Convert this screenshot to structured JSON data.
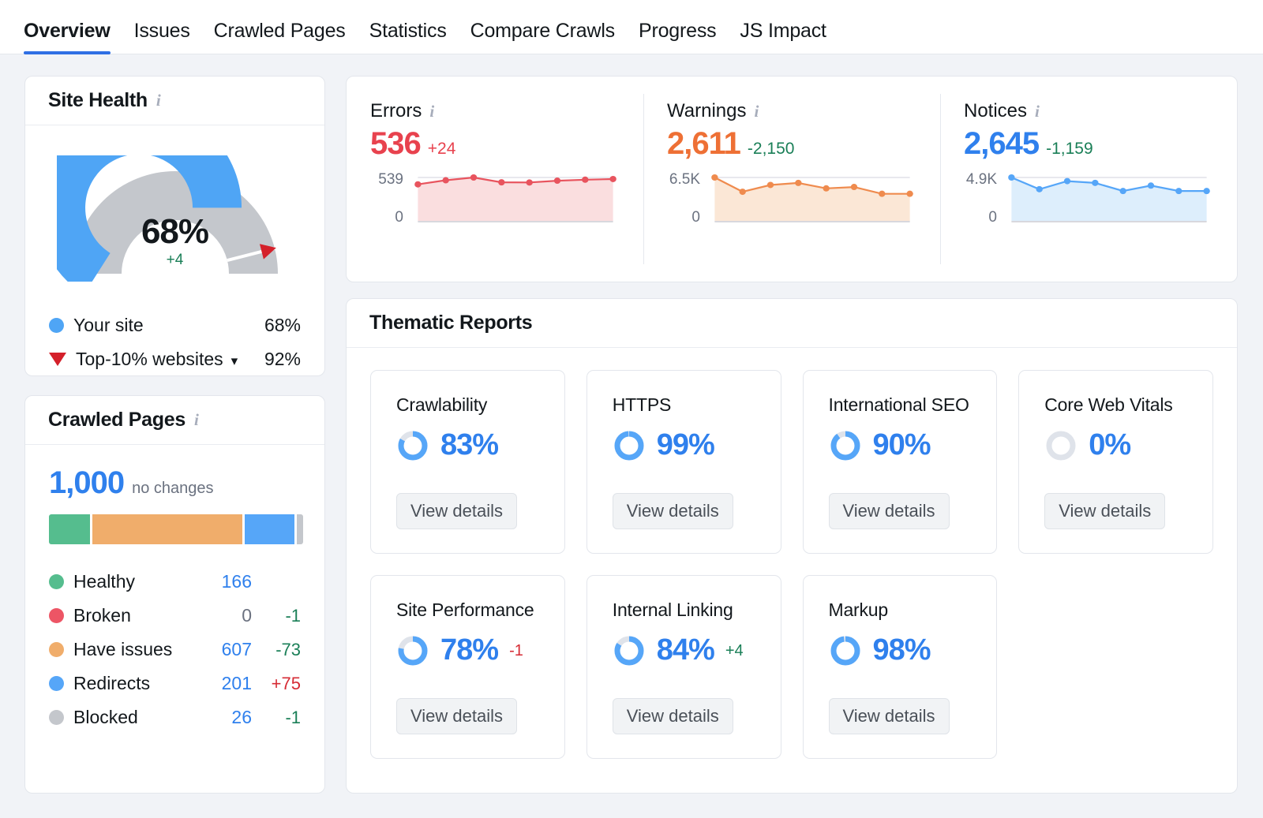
{
  "tabs": [
    {
      "label": "Overview",
      "active": true
    },
    {
      "label": "Issues",
      "active": false
    },
    {
      "label": "Crawled Pages",
      "active": false
    },
    {
      "label": "Statistics",
      "active": false
    },
    {
      "label": "Compare Crawls",
      "active": false
    },
    {
      "label": "Progress",
      "active": false
    },
    {
      "label": "JS Impact",
      "active": false
    }
  ],
  "site_health": {
    "title": "Site Health",
    "score": "68%",
    "delta": "+4",
    "legend": [
      {
        "label": "Your site",
        "value": "68%",
        "color": "#4fa5f5",
        "marker": "dot"
      },
      {
        "label": "Top-10% websites",
        "value": "92%",
        "color": "#d4202a",
        "marker": "triangle",
        "chevron": "⌄"
      }
    ],
    "chart_data": {
      "type": "gauge",
      "title": "Site Health",
      "value": 68,
      "benchmark": 92,
      "range": [
        0,
        100
      ],
      "series": [
        {
          "name": "Your site",
          "value": 68,
          "color": "#4fa5f5"
        },
        {
          "name": "Remaining",
          "value": 32,
          "color": "#c4c7cc"
        }
      ],
      "marker": {
        "name": "Top-10% websites",
        "value": 92,
        "color": "#d4202a"
      }
    }
  },
  "crawled_pages": {
    "title": "Crawled Pages",
    "total": "1,000",
    "total_note": "no changes",
    "rows": [
      {
        "label": "Healthy",
        "count": "166",
        "delta": "",
        "color": "#55bd8e",
        "count_style": "link",
        "delta_style": ""
      },
      {
        "label": "Broken",
        "count": "0",
        "delta": "-1",
        "color": "#ed5565",
        "count_style": "zero",
        "delta_style": "neg"
      },
      {
        "label": "Have issues",
        "count": "607",
        "delta": "-73",
        "color": "#f0ad6b",
        "count_style": "link",
        "delta_style": "neg"
      },
      {
        "label": "Redirects",
        "count": "201",
        "delta": "+75",
        "color": "#56a6f8",
        "count_style": "link",
        "delta_style": "pos"
      },
      {
        "label": "Blocked",
        "count": "26",
        "delta": "-1",
        "color": "#c4c7cc",
        "count_style": "link",
        "delta_style": "neg"
      }
    ],
    "chart_data": {
      "type": "bar",
      "subtype": "stacked-horizontal",
      "title": "Crawled Pages",
      "total": 1000,
      "categories": [
        "Healthy",
        "Broken",
        "Have issues",
        "Redirects",
        "Blocked"
      ],
      "values": [
        166,
        0,
        607,
        201,
        26
      ],
      "colors": [
        "#55bd8e",
        "#ed5565",
        "#f0ad6b",
        "#56a6f8",
        "#c4c7cc"
      ],
      "deltas": [
        null,
        -1,
        -73,
        75,
        -1
      ]
    }
  },
  "metrics": [
    {
      "name": "Errors",
      "value": "536",
      "delta": "+24",
      "value_color": "#e8424e",
      "delta_color": "#e8424e",
      "axis_top": "539",
      "axis_bottom": "0",
      "line_color": "#e8545e",
      "fill_color": "#fadedf",
      "chart_data": {
        "type": "line",
        "title": "Errors",
        "ylabel": "",
        "ylim": [
          0,
          539
        ],
        "points": [
          455,
          505,
          539,
          480,
          478,
          500,
          512,
          520
        ],
        "tick_labels": [
          "0",
          "539"
        ]
      }
    },
    {
      "name": "Warnings",
      "value": "2,611",
      "delta": "-2,150",
      "value_color": "#ee7035",
      "delta_color": "#1a7f57",
      "axis_top": "6.5K",
      "axis_bottom": "0",
      "line_color": "#ef8b4e",
      "fill_color": "#fbe7d6",
      "chart_data": {
        "type": "line",
        "title": "Warnings",
        "ylabel": "",
        "ylim": [
          0,
          6500
        ],
        "points": [
          6500,
          4400,
          5400,
          5700,
          4900,
          5100,
          4100,
          4100
        ],
        "tick_labels": [
          "0",
          "6.5K"
        ]
      }
    },
    {
      "name": "Notices",
      "value": "2,645",
      "delta": "-1,159",
      "value_color": "#2f80ed",
      "delta_color": "#1a7f57",
      "axis_top": "4.9K",
      "axis_bottom": "0",
      "line_color": "#56a6f8",
      "fill_color": "#ddeefc",
      "chart_data": {
        "type": "line",
        "title": "Notices",
        "ylabel": "",
        "ylim": [
          0,
          4900
        ],
        "points": [
          4900,
          3600,
          4500,
          4300,
          3400,
          4000,
          3400,
          3400
        ],
        "tick_labels": [
          "0",
          "4.9K"
        ]
      }
    }
  ],
  "thematic": {
    "title": "Thematic Reports",
    "button_label": "View details",
    "cards": [
      {
        "name": "Crawlability",
        "pct": "83%",
        "value": 83,
        "delta": "",
        "delta_style": ""
      },
      {
        "name": "HTTPS",
        "pct": "99%",
        "value": 99,
        "delta": "",
        "delta_style": ""
      },
      {
        "name": "International SEO",
        "pct": "90%",
        "value": 90,
        "delta": "",
        "delta_style": ""
      },
      {
        "name": "Core Web Vitals",
        "pct": "0%",
        "value": 0,
        "delta": "",
        "delta_style": ""
      },
      {
        "name": "Site Performance",
        "pct": "78%",
        "value": 78,
        "delta": "-1",
        "delta_style": "pos"
      },
      {
        "name": "Internal Linking",
        "pct": "84%",
        "value": 84,
        "delta": "+4",
        "delta_style": "neg"
      },
      {
        "name": "Markup",
        "pct": "98%",
        "value": 98,
        "delta": "",
        "delta_style": ""
      }
    ]
  },
  "colors": {
    "accent_blue": "#2f80ed",
    "gauge_blue": "#4fa5f5",
    "gray": "#c4c7cc",
    "green": "#1a7f57",
    "red": "#d62b34"
  }
}
